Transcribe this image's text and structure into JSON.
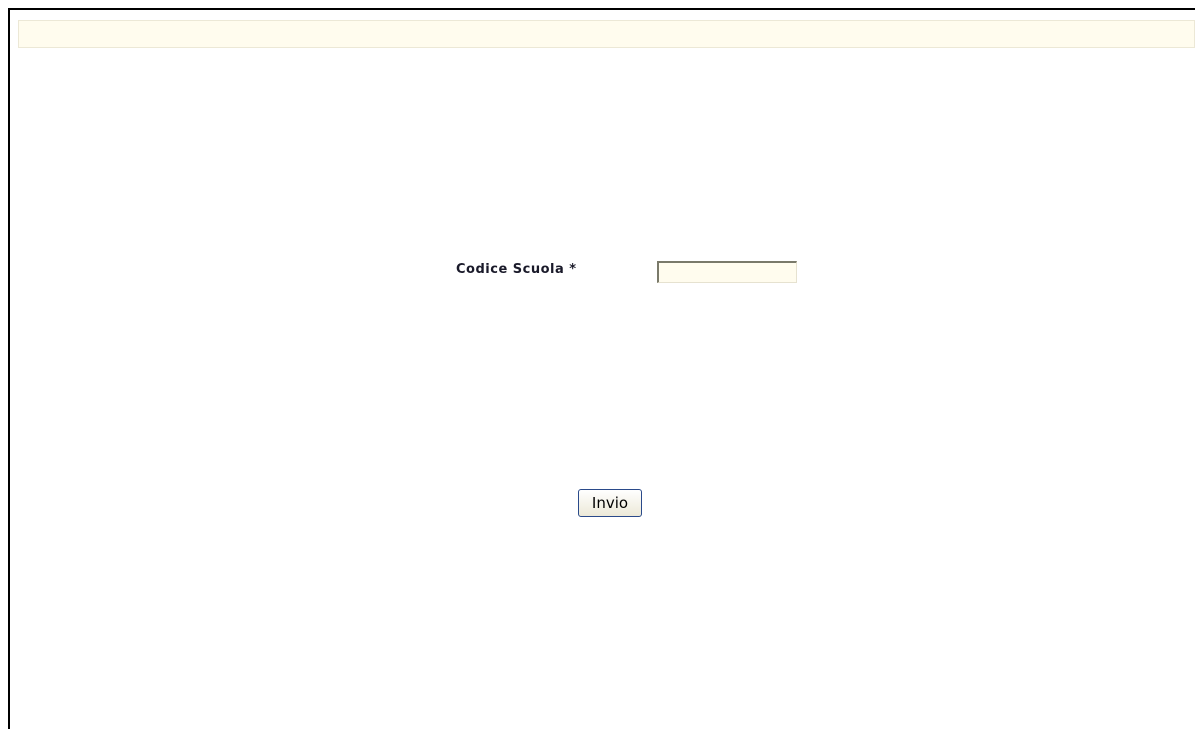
{
  "form": {
    "school_code_label": "Codice Scuola *",
    "school_code_value": "",
    "submit_label": "Invio"
  },
  "colors": {
    "header_bar_bg": "#fffcee",
    "input_bg": "#fffcee",
    "button_border": "#2a4a8a"
  }
}
